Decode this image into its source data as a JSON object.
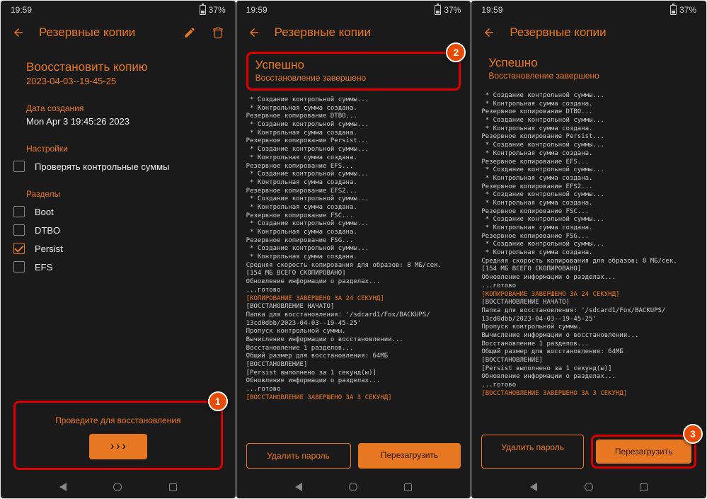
{
  "status": {
    "time": "19:59",
    "battery": "37%"
  },
  "header": {
    "title": "Резервные копии"
  },
  "screen1": {
    "restore_title": "Воосстановить копию",
    "restore_sub": "2023-04-03--19-45-25",
    "date_label": "Дата создания",
    "date_value": "Mon Apr  3 19:45:26 2023",
    "settings_label": "Настройки",
    "checksum_label": "Проверять контрольные суммы",
    "partitions_label": "Разделы",
    "partitions": [
      {
        "label": "Boot",
        "checked": false
      },
      {
        "label": "DTBO",
        "checked": false
      },
      {
        "label": "Persist",
        "checked": true
      },
      {
        "label": "EFS",
        "checked": false
      }
    ],
    "slide_label": "Проведите для восстановления",
    "badge": "1"
  },
  "screen2": {
    "success_title": "Успешно",
    "success_sub": "Восстановление завершено",
    "badge": "2",
    "btn_delete": "Удалить пароль",
    "btn_reboot": "Перезагрузить"
  },
  "screen3": {
    "success_title": "Успешно",
    "success_sub": "Восстановление завершено",
    "badge": "3",
    "btn_delete": "Удалить пароль",
    "btn_reboot": "Перезагрузить"
  },
  "log_lines": [
    {
      "t": " * Создание контрольной суммы...",
      "c": 0
    },
    {
      "t": " * Контрольная сумма создана.",
      "c": 0
    },
    {
      "t": "Резервное копирование DTBO...",
      "c": 0
    },
    {
      "t": " * Создание контрольной суммы...",
      "c": 0
    },
    {
      "t": " * Контрольная сумма создана.",
      "c": 0
    },
    {
      "t": "Резервное копирование Persist...",
      "c": 0
    },
    {
      "t": " * Создание контрольной суммы...",
      "c": 0
    },
    {
      "t": " * Контрольная сумма создана.",
      "c": 0
    },
    {
      "t": "Резервное копирование EFS...",
      "c": 0
    },
    {
      "t": " * Создание контрольной суммы...",
      "c": 0
    },
    {
      "t": " * Контрольная сумма создана.",
      "c": 0
    },
    {
      "t": "Резервное копирование EFS2...",
      "c": 0
    },
    {
      "t": " * Создание контрольной суммы...",
      "c": 0
    },
    {
      "t": " * Контрольная сумма создана.",
      "c": 0
    },
    {
      "t": "Резервное копирование FSC...",
      "c": 0
    },
    {
      "t": " * Создание контрольной суммы...",
      "c": 0
    },
    {
      "t": " * Контрольная сумма создана.",
      "c": 0
    },
    {
      "t": "Резервное копирование FSG...",
      "c": 0
    },
    {
      "t": " * Создание контрольной суммы...",
      "c": 0
    },
    {
      "t": " * Контрольная сумма создана.",
      "c": 0
    },
    {
      "t": "Средняя скорость копирования для образов: 8 МБ/сек.",
      "c": 0
    },
    {
      "t": "[154 МБ ВСЕГО СКОПИРОВАНО]",
      "c": 0
    },
    {
      "t": "Обновление информации о разделах...",
      "c": 0
    },
    {
      "t": "...готово",
      "c": 0
    },
    {
      "t": "[КОПИРОВАНИЕ ЗАВЕРШЕНО ЗА 24 СЕКУНД]",
      "c": 1
    },
    {
      "t": "[ВОССТАНОВЛЕНИЕ НАЧАТО]",
      "c": 0
    },
    {
      "t": "Папка для восстановления: '/sdcard1/Fox/BACKUPS/",
      "c": 0
    },
    {
      "t": "13cd0dbb/2023-04-03--19-45-25'",
      "c": 0
    },
    {
      "t": "Пропуск контрольной суммы.",
      "c": 0
    },
    {
      "t": "Вычисление информации о восстановлении...",
      "c": 0
    },
    {
      "t": "Восстановление 1 разделов...",
      "c": 0
    },
    {
      "t": "Общий размер для восстановления: 64МБ",
      "c": 0
    },
    {
      "t": "[ВОССТАНОВЛЕНИЕ]",
      "c": 0
    },
    {
      "t": "[Persist выполнено за 1 секунд(ы)]",
      "c": 0
    },
    {
      "t": "Обновление информации о разделах...",
      "c": 0
    },
    {
      "t": "...готово",
      "c": 0
    },
    {
      "t": "[ВОССТАНОВЛЕНИЕ ЗАВЕРШЕНО ЗА 3 СЕКУНД]",
      "c": 1
    }
  ]
}
